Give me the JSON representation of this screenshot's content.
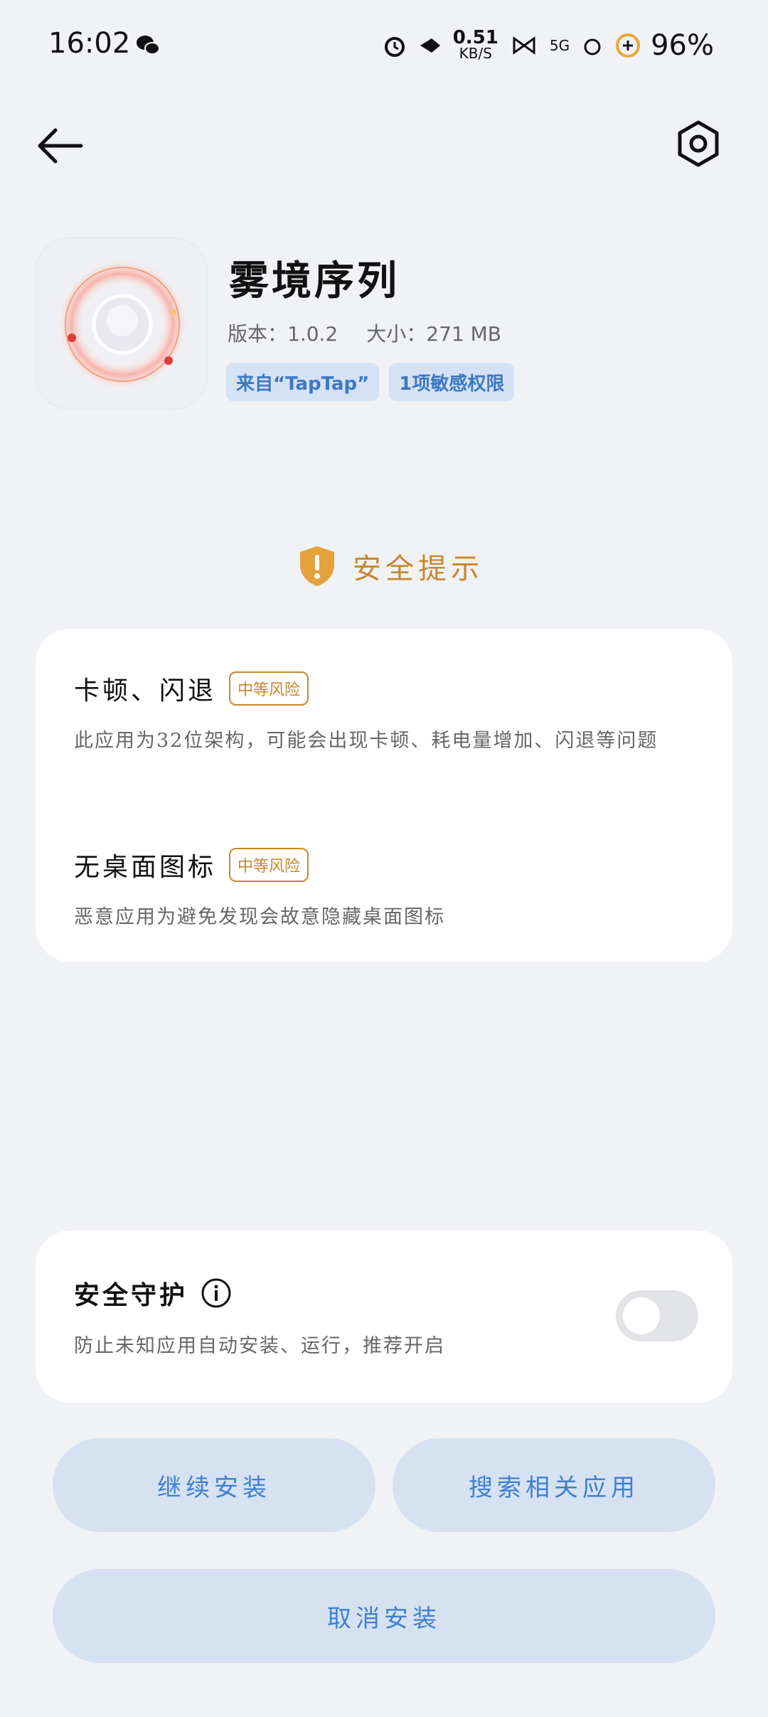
{
  "status_bar": {
    "time": "16:02",
    "net_speed_value": "0.51",
    "net_speed_unit": "KB/S",
    "network": "5G",
    "battery": "96%",
    "icons": [
      "wechat-icon",
      "alarm-icon",
      "fish-icon",
      "bow-icon",
      "signal-icon",
      "battery-icon"
    ]
  },
  "app": {
    "name": "雾境序列",
    "version_label": "版本：1.0.2",
    "size_label": "大小：271 MB",
    "tags": [
      "来自“TapTap”",
      "1项敏感权限"
    ]
  },
  "security": {
    "title": "安全提示",
    "risks": [
      {
        "title": "卡顿、闪退",
        "badge": "中等风险",
        "desc": "此应用为32位架构，可能会出现卡顿、耗电量增加、闪退等问题"
      },
      {
        "title": "无桌面图标",
        "badge": "中等风险",
        "desc": "恶意应用为避免发现会故意隐藏桌面图标"
      }
    ]
  },
  "guard": {
    "title": "安全守护",
    "desc": "防止未知应用自动安装、运行，推荐开启",
    "enabled": false
  },
  "buttons": {
    "continue": "继续安装",
    "search": "搜索相关应用",
    "cancel": "取消安装"
  },
  "colors": {
    "accent_blue": "#3f7fd1",
    "warning_orange": "#c8862e",
    "button_bg": "#d6e2f2",
    "page_bg": "#f0f2f5"
  }
}
